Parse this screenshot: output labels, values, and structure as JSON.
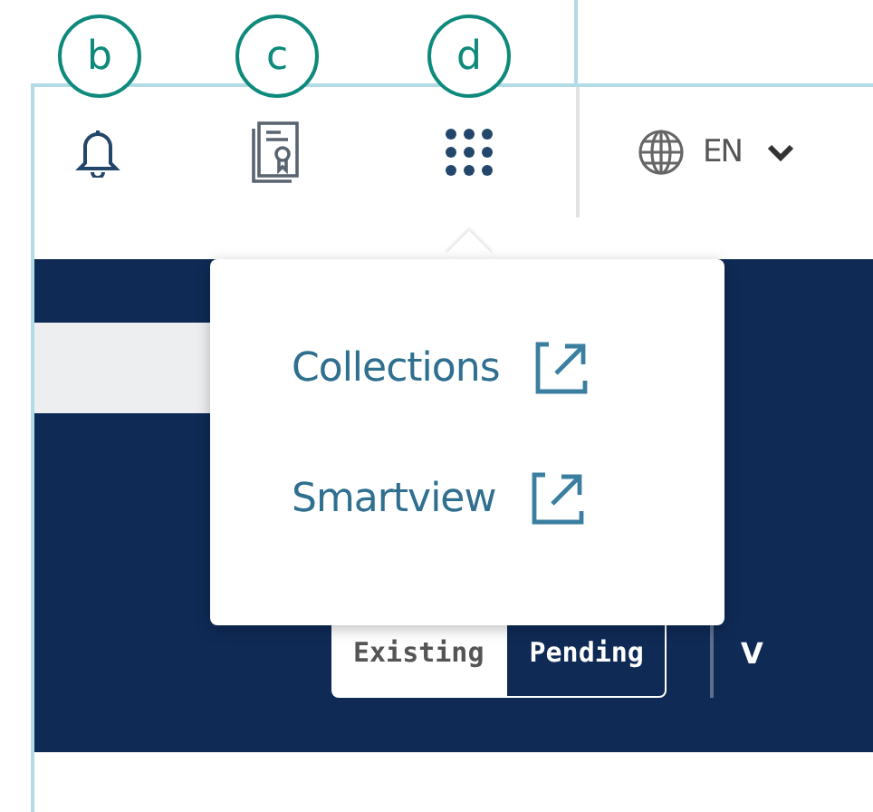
{
  "callouts": [
    {
      "label": "b"
    },
    {
      "label": "c"
    },
    {
      "label": "d"
    }
  ],
  "header": {
    "language": "EN"
  },
  "apps_menu": {
    "items": [
      {
        "label": "Collections"
      },
      {
        "label": "Smartview"
      }
    ]
  },
  "view_toggle": {
    "options": [
      {
        "label": "Existing",
        "selected": false
      },
      {
        "label": "Pending",
        "selected": true
      }
    ]
  },
  "toolbar_cut_text": "V"
}
